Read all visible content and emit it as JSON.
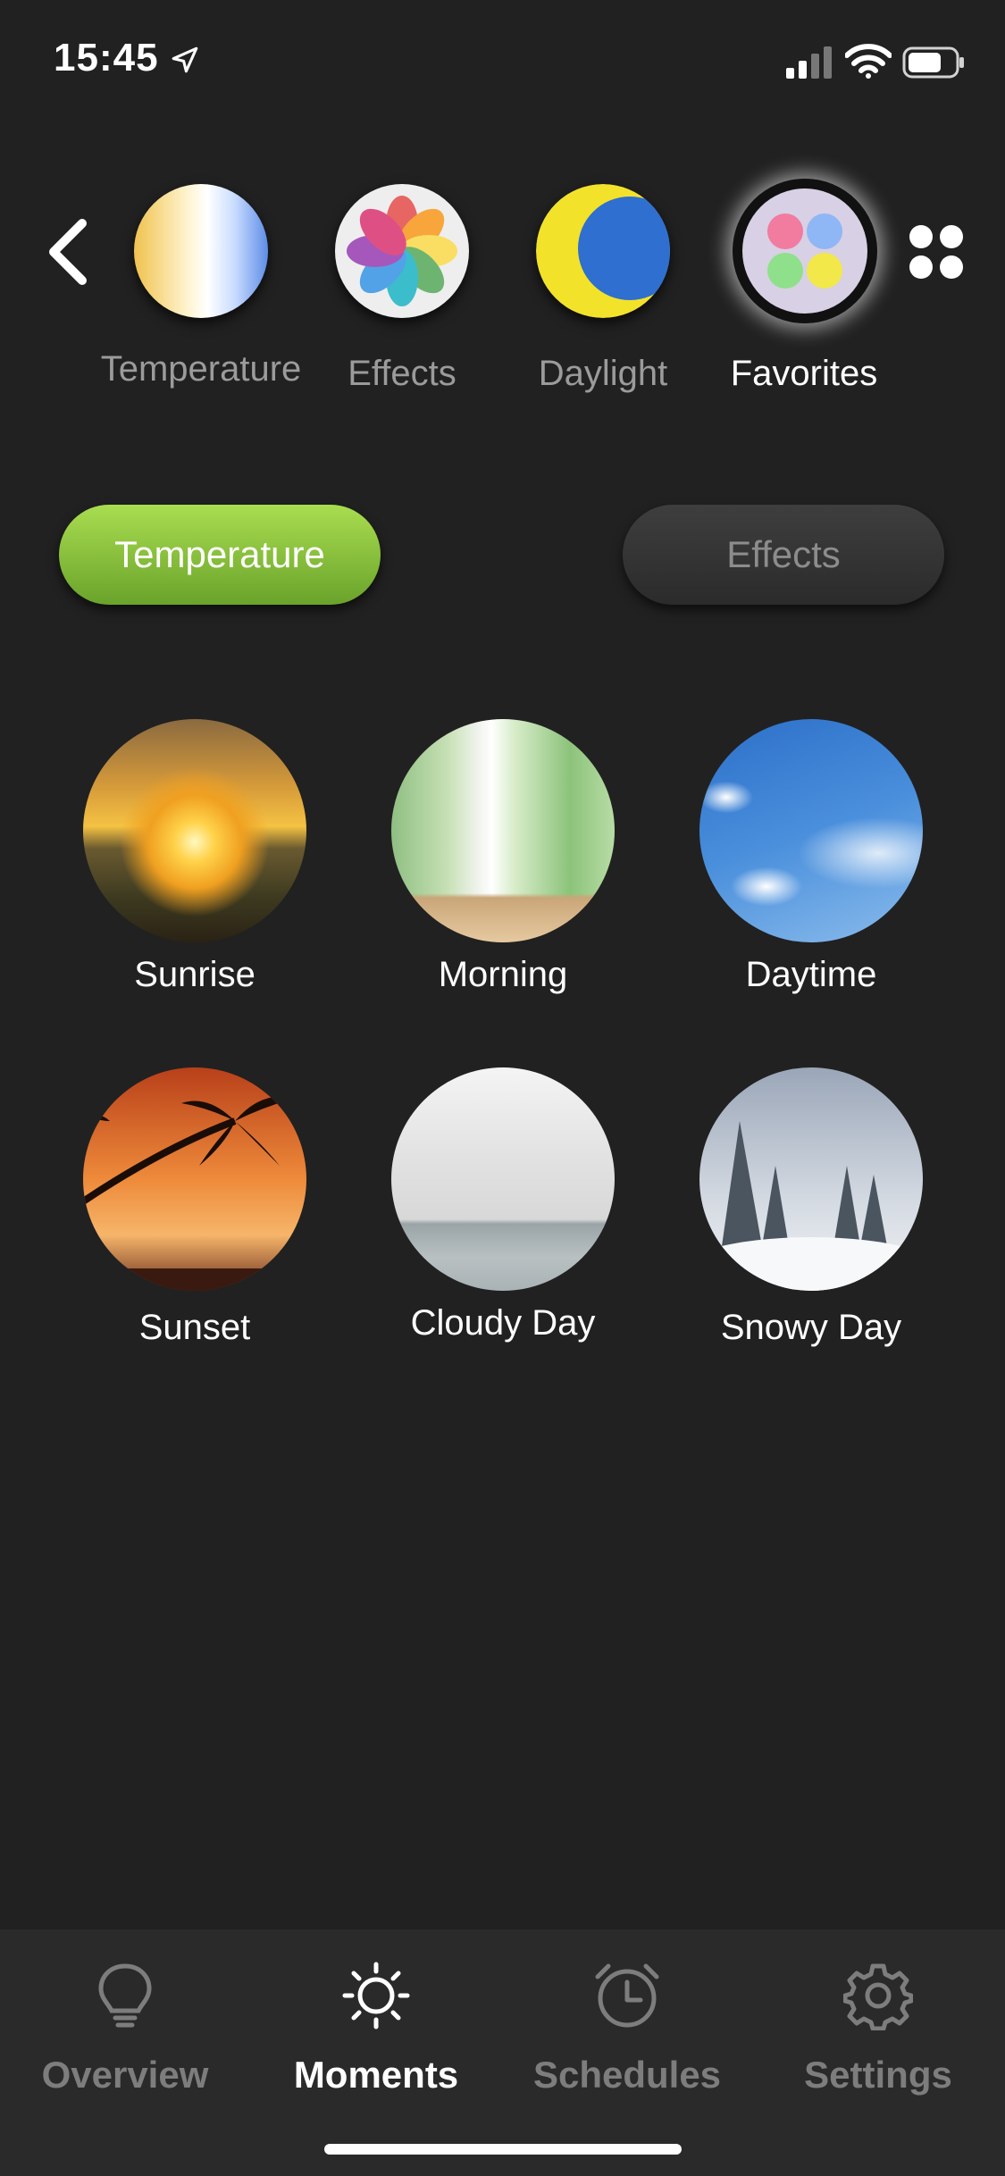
{
  "status": {
    "time": "15:45"
  },
  "modes": [
    {
      "label": "Temperature",
      "active": false
    },
    {
      "label": "Effects",
      "active": false
    },
    {
      "label": "Daylight",
      "active": false
    },
    {
      "label": "Favorites",
      "active": true
    }
  ],
  "segments": {
    "temperature": "Temperature",
    "effects": "Effects",
    "selected": "Temperature"
  },
  "moments": [
    {
      "name": "Sunrise"
    },
    {
      "name": "Morning"
    },
    {
      "name": "Daytime"
    },
    {
      "name": "Sunset"
    },
    {
      "name": "Cloudy Day"
    },
    {
      "name": "Snowy Day"
    }
  ],
  "tabs": [
    {
      "label": "Overview",
      "icon": "bulb-icon"
    },
    {
      "label": "Moments",
      "icon": "sun-icon"
    },
    {
      "label": "Schedules",
      "icon": "alarm-clock-icon"
    },
    {
      "label": "Settings",
      "icon": "gear-icon"
    }
  ],
  "active_tab": "Moments",
  "colors": {
    "background": "#212121",
    "accent_green": "#8cc63f",
    "tabbar": "#2a2a2a"
  }
}
